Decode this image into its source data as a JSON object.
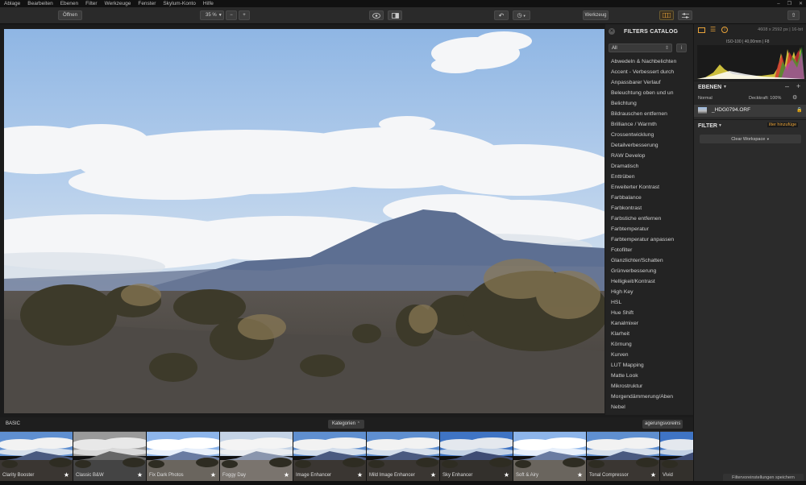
{
  "menu": [
    "Ablage",
    "Bearbeiten",
    "Ebenen",
    "Filter",
    "Werkzeuge",
    "Fenster",
    "Skylum-Konto",
    "Hilfe"
  ],
  "toolbar": {
    "open_label": "Öffnen",
    "zoom": "35 %",
    "zoom_minus": "−",
    "zoom_plus": "+",
    "tools_label": "Werkzeug"
  },
  "catalog": {
    "title": "FILTERS CATALOG",
    "filter_select": "All",
    "items": [
      "Abwedeln & Nachbelichten",
      "Accent - Verbessert durch",
      "Anpassbarer Verlauf",
      "Beleuchtung oben und un",
      "Belichtung",
      "Bildrauschen entfernen",
      "Brilliance / Warmth",
      "Crossentwicklung",
      "Detailverbesserung",
      "RAW Develop",
      "Dramatisch",
      "Enttrüben",
      "Erweiterter Kontrast",
      "Farbbalance",
      "Farbkontrast",
      "Farbstiche entfernen",
      "Farbtemperatur",
      "Farbtemperatur anpassen",
      "Fotofilter",
      "Glanzlichter/Schatten",
      "Grünverbesserung",
      "Helligkeit/Kontrast",
      "High Key",
      "HSL",
      "Hue Shift",
      "Kanalmixer",
      "Klarheit",
      "Körnung",
      "Kurven",
      "LUT Mapping",
      "Matte Look",
      "Mikrostruktur",
      "Morgendämmerung/Aben",
      "Nebel"
    ]
  },
  "right_panel": {
    "image_meta": "4608 x 2592 px  |  16-bit",
    "exif": "ISO-100  |  40,00mm  |  F8",
    "layers_title": "EBENEN",
    "blend_mode": "Normal",
    "opacity": "Deckkraft: 100%",
    "layer_name": "_HDG0794.ORF",
    "filter_title": "FILTER",
    "add_filter": "ilter hinzufüge",
    "workspace": "Clear Workspace",
    "save_presets": "Filtervoreinstellungen speichern"
  },
  "bottom": {
    "category_tab": "BASIC",
    "categories_btn": "Kategorien",
    "presets_btn": "agerungsvoreins"
  },
  "presets": [
    {
      "label": "Clarity Booster",
      "style": "color"
    },
    {
      "label": "Classic B&W",
      "style": "bw"
    },
    {
      "label": "Fix Dark Photos",
      "style": "bright"
    },
    {
      "label": "Foggy Day",
      "style": "foggy"
    },
    {
      "label": "Image Enhancer",
      "style": "color"
    },
    {
      "label": "Mild Image Enhancer",
      "style": "color"
    },
    {
      "label": "Sky Enhancer",
      "style": "deep"
    },
    {
      "label": "Soft & Airy",
      "style": "bright"
    },
    {
      "label": "Tonal Compressor",
      "style": "color"
    },
    {
      "label": "Vivid",
      "style": "deep"
    }
  ],
  "colors": {
    "accent": "#e8a33a",
    "panel": "#2b2b2b"
  }
}
